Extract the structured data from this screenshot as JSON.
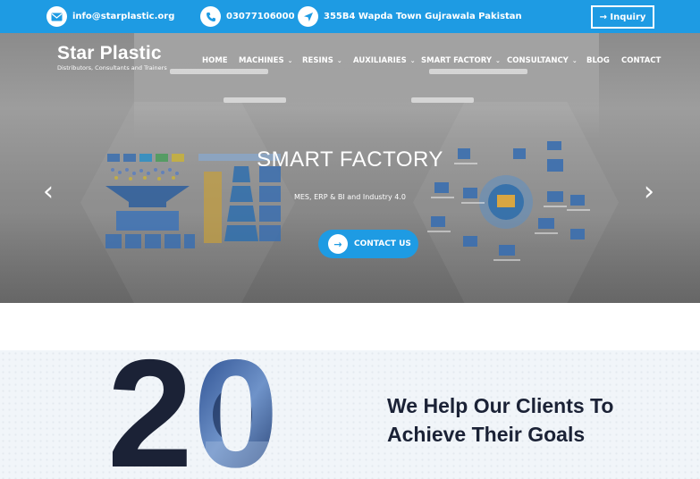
{
  "topbar": {
    "email": "info@starplastic.org",
    "phone": "03077106000",
    "address": "355B4 Wapda Town Gujrawala Pakistan",
    "inquiry_label": "→ Inquiry",
    "icons": [
      "mail-icon",
      "phone-icon",
      "location-arrow-icon"
    ]
  },
  "brand": {
    "name": "Star Plastic",
    "tagline": "Distributors, Consultants and Trainers"
  },
  "nav": {
    "items": [
      {
        "label": "HOME",
        "dropdown": false
      },
      {
        "label": "MACHINES",
        "dropdown": true
      },
      {
        "label": "RESINS",
        "dropdown": true
      },
      {
        "label": "AUXILIARIES",
        "dropdown": true
      },
      {
        "label": "SMART FACTORY",
        "dropdown": true
      },
      {
        "label": "CONSULTANCY",
        "dropdown": true
      },
      {
        "label": "BLOG",
        "dropdown": false
      },
      {
        "label": "CONTACT",
        "dropdown": false
      }
    ]
  },
  "hero": {
    "title": "SMART FACTORY",
    "subtitle": "MES, ERP & BI and Industry 4.0",
    "cta_label": "CONTACT US",
    "prev_symbol": "‹",
    "next_symbol": "›"
  },
  "section": {
    "big_number": "20",
    "headline_line1": "We Help Our Clients To",
    "headline_line2": "Achieve Their Goals"
  },
  "colors": {
    "accent": "#1e9be3",
    "heading": "#1b2236",
    "number_dark": "#1b2236"
  }
}
